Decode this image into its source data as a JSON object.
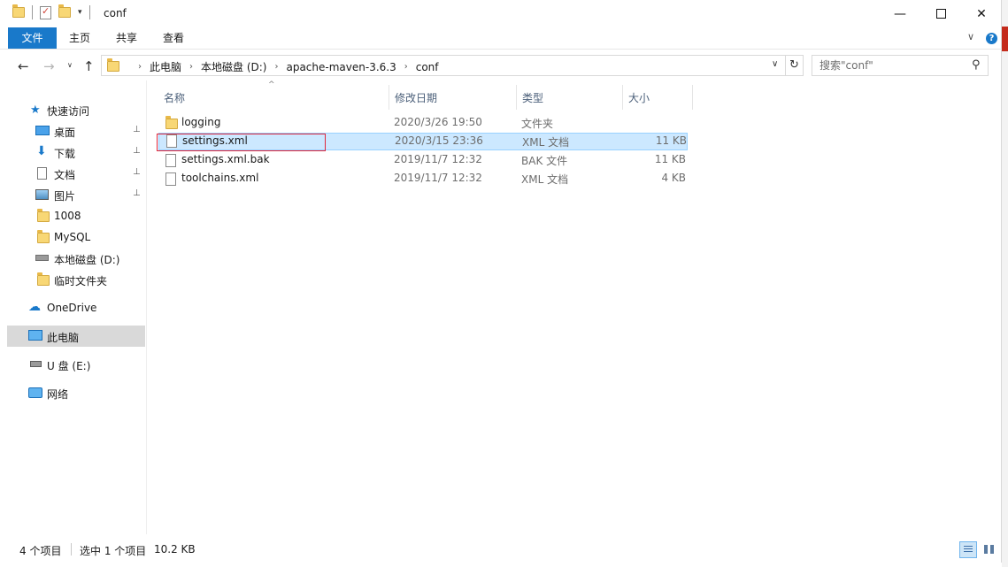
{
  "window": {
    "title": "conf",
    "minimize_glyph": "—",
    "close_glyph": "✕"
  },
  "ribbon": {
    "tabs": [
      "文件",
      "主页",
      "共享",
      "查看"
    ],
    "help_glyph": "?"
  },
  "address": {
    "crumbs": [
      "此电脑",
      "本地磁盘 (D:)",
      "apache-maven-3.6.3",
      "conf"
    ]
  },
  "search": {
    "placeholder": "搜索\"conf\""
  },
  "nav_pane": {
    "items": [
      {
        "label": "快速访问",
        "icon": "star-icon"
      },
      {
        "label": "桌面",
        "icon": "desktop-icon",
        "pinned": true
      },
      {
        "label": "下载",
        "icon": "download-icon",
        "pinned": true
      },
      {
        "label": "文档",
        "icon": "document-icon",
        "pinned": true
      },
      {
        "label": "图片",
        "icon": "pictures-icon",
        "pinned": true
      },
      {
        "label": "1008",
        "icon": "folder-icon"
      },
      {
        "label": "MySQL",
        "icon": "folder-icon"
      },
      {
        "label": "本地磁盘 (D:)",
        "icon": "drive-icon"
      },
      {
        "label": "临时文件夹",
        "icon": "folder-icon"
      },
      {
        "label": "OneDrive",
        "icon": "cloud-icon"
      },
      {
        "label": "此电脑",
        "icon": "computer-icon",
        "selected": true
      },
      {
        "label": "U 盘 (E:)",
        "icon": "usb-drive-icon"
      },
      {
        "label": "网络",
        "icon": "network-icon"
      }
    ]
  },
  "file_list": {
    "columns": [
      "名称",
      "修改日期",
      "类型",
      "大小"
    ],
    "rows": [
      {
        "name": "logging",
        "date": "2020/3/26 19:50",
        "type": "文件夹",
        "size": "",
        "icon": "folder-icon"
      },
      {
        "name": "settings.xml",
        "date": "2020/3/15 23:36",
        "type": "XML 文档",
        "size": "11 KB",
        "icon": "file-icon",
        "selected": true
      },
      {
        "name": "settings.xml.bak",
        "date": "2019/11/7 12:32",
        "type": "BAK 文件",
        "size": "11 KB",
        "icon": "file-icon"
      },
      {
        "name": "toolchains.xml",
        "date": "2019/11/7 12:32",
        "type": "XML 文档",
        "size": "4 KB",
        "icon": "file-icon"
      }
    ]
  },
  "status": {
    "count": "4 个项目",
    "selected": "选中 1 个项目",
    "size": "10.2 KB"
  },
  "colors": {
    "accent": "#1979ca",
    "selection": "#cce8ff",
    "highlight_border": "#e0263a"
  }
}
